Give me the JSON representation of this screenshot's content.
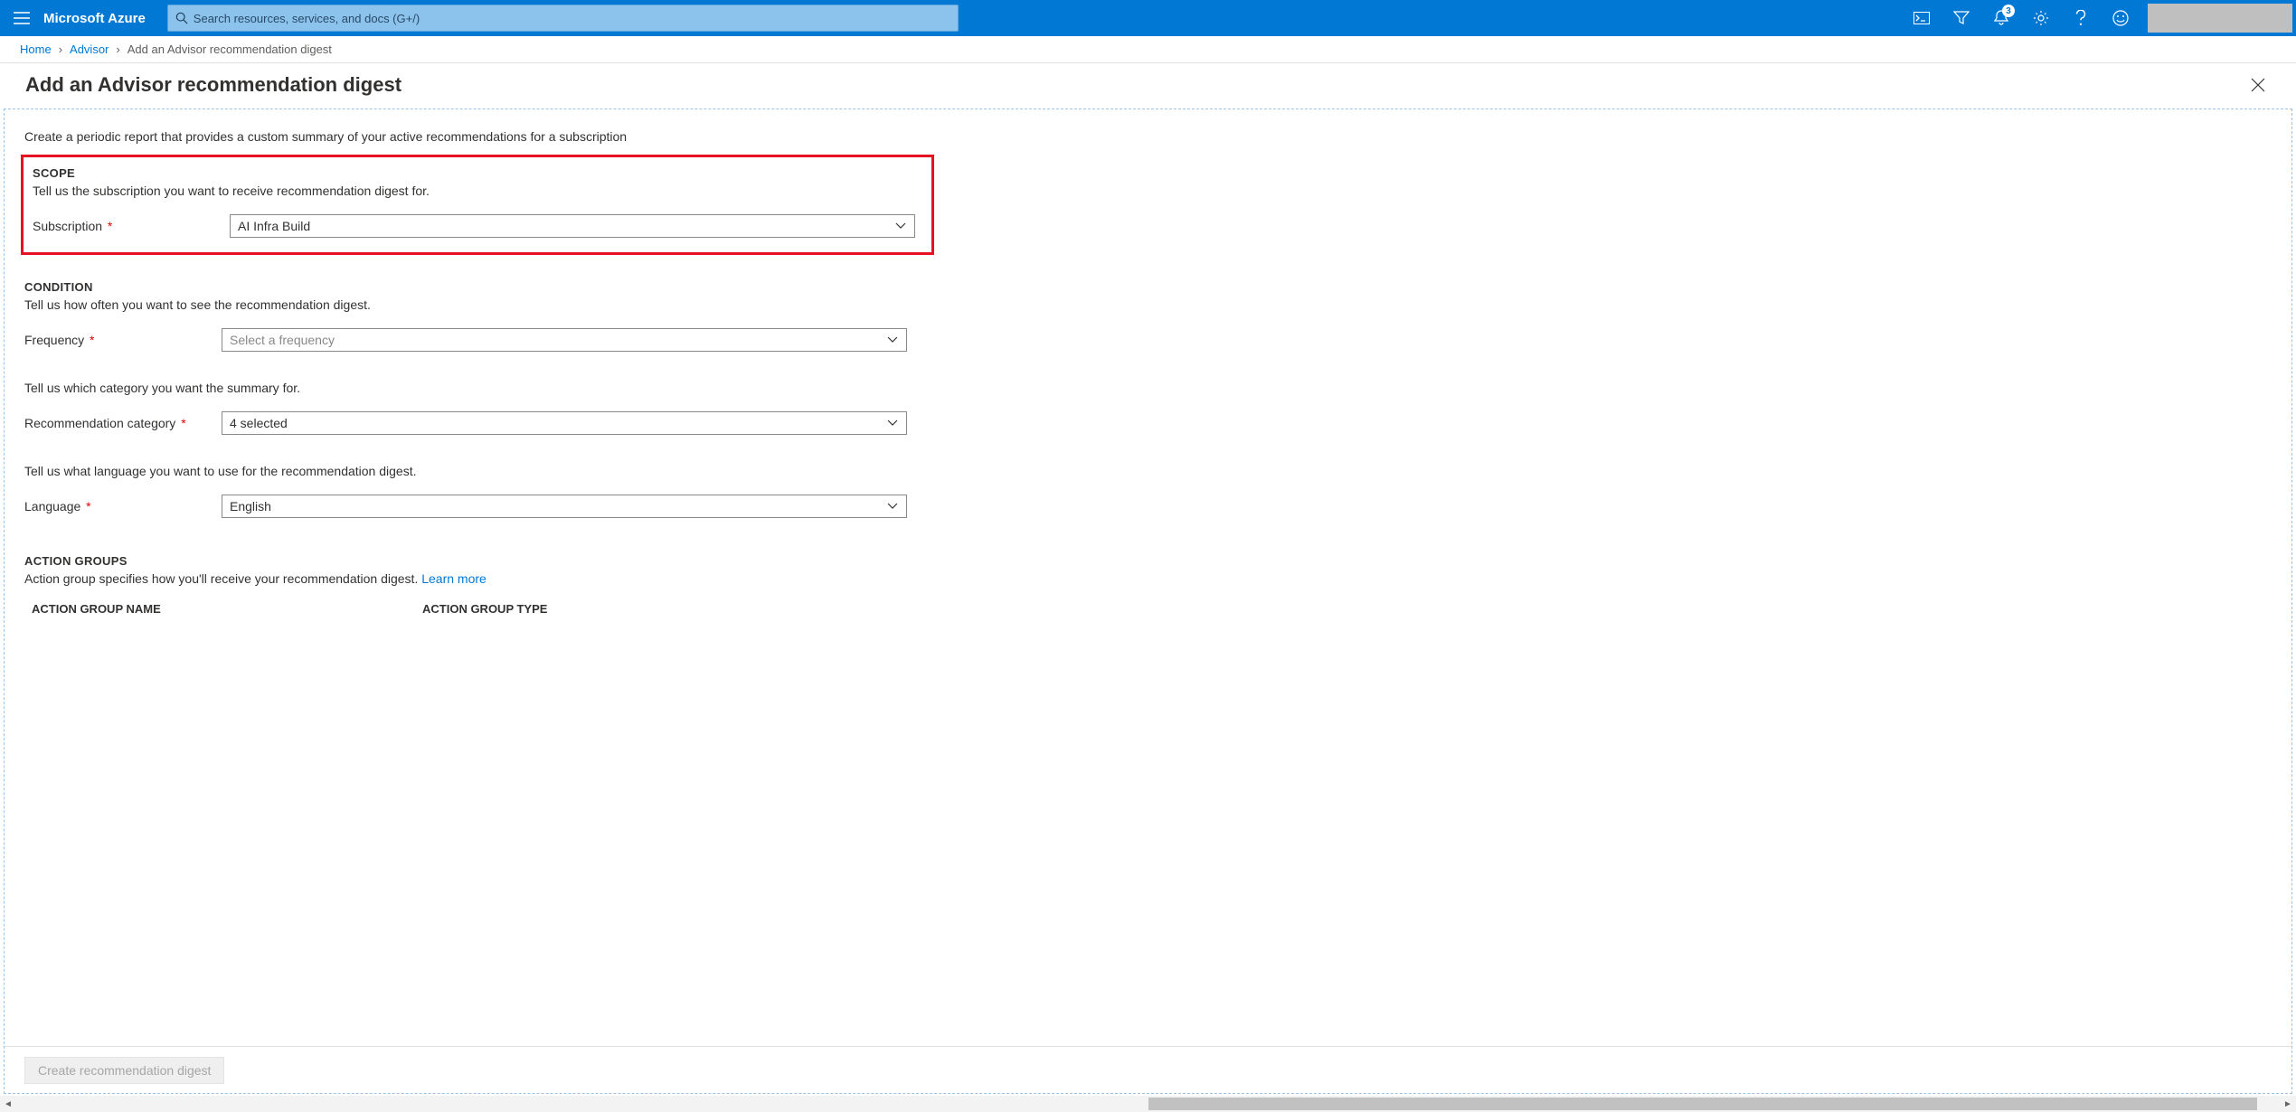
{
  "topbar": {
    "brand": "Microsoft Azure",
    "search_placeholder": "Search resources, services, and docs (G+/)",
    "notification_count": "3"
  },
  "breadcrumbs": {
    "home": "Home",
    "advisor": "Advisor",
    "current": "Add an Advisor recommendation digest"
  },
  "page": {
    "title": "Add an Advisor recommendation digest",
    "intro": "Create a periodic report that provides a custom summary of your active recommendations for a subscription"
  },
  "scope": {
    "title": "SCOPE",
    "desc": "Tell us the subscription you want to receive recommendation digest for.",
    "subscription_label": "Subscription",
    "subscription_value": "AI Infra Build"
  },
  "condition": {
    "title": "CONDITION",
    "desc_freq": "Tell us how often you want to see the recommendation digest.",
    "frequency_label": "Frequency",
    "frequency_placeholder": "Select a frequency",
    "desc_cat": "Tell us which category you want the summary for.",
    "category_label": "Recommendation category",
    "category_value": "4 selected",
    "desc_lang": "Tell us what language you want to use for the recommendation digest.",
    "language_label": "Language",
    "language_value": "English"
  },
  "action_groups": {
    "title": "ACTION GROUPS",
    "desc": "Action group specifies how you'll receive your recommendation digest. ",
    "learn_more": "Learn more",
    "col_name": "ACTION GROUP NAME",
    "col_type": "ACTION GROUP TYPE"
  },
  "footer": {
    "create_label": "Create recommendation digest"
  }
}
